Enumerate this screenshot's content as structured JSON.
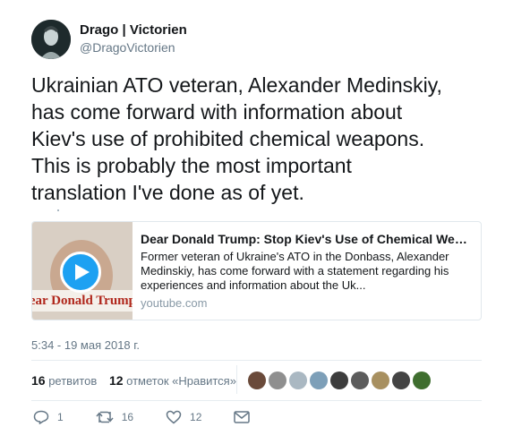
{
  "author": {
    "name": "Drago | Victorien",
    "handle": "@DragoVictorien"
  },
  "tweet": {
    "text_lines": [
      "Ukrainian ATO veteran, Alexander Medinskiy,",
      "has come forward with information about",
      "Kiev's use of prohibited chemical weapons.",
      "This is probably the most important",
      "translation I've done as of yet."
    ]
  },
  "card": {
    "title": "Dear Donald Trump: Stop Kiev's Use of Chemical Weapons",
    "description_lines": [
      "Former veteran of Ukraine's ATO in the Donbass, Alexander",
      "Medinskiy, has come forward with a statement regarding his",
      "experiences and information about the Uk..."
    ],
    "domain": "youtube.com",
    "thumbnail_text": "Dear Donald Trump"
  },
  "timestamp": "5:34 - 19 мая 2018 г.",
  "stats": {
    "retweets_count": "16",
    "retweets_label": "ретвитов",
    "likes_count": "12",
    "likes_label": "отметок «Нравится»"
  },
  "liker_colors": [
    "#6a4a3a",
    "#8f8f8f",
    "#aab8c2",
    "#7d9fb8",
    "#3d3d3d",
    "#5c5c5c",
    "#a89060",
    "#444444",
    "#3f6e2f"
  ],
  "actions": {
    "reply_count": "1",
    "retweet_count": "16",
    "like_count": "12"
  },
  "colors": {
    "accent": "#1da1f2",
    "muted": "#657786"
  }
}
